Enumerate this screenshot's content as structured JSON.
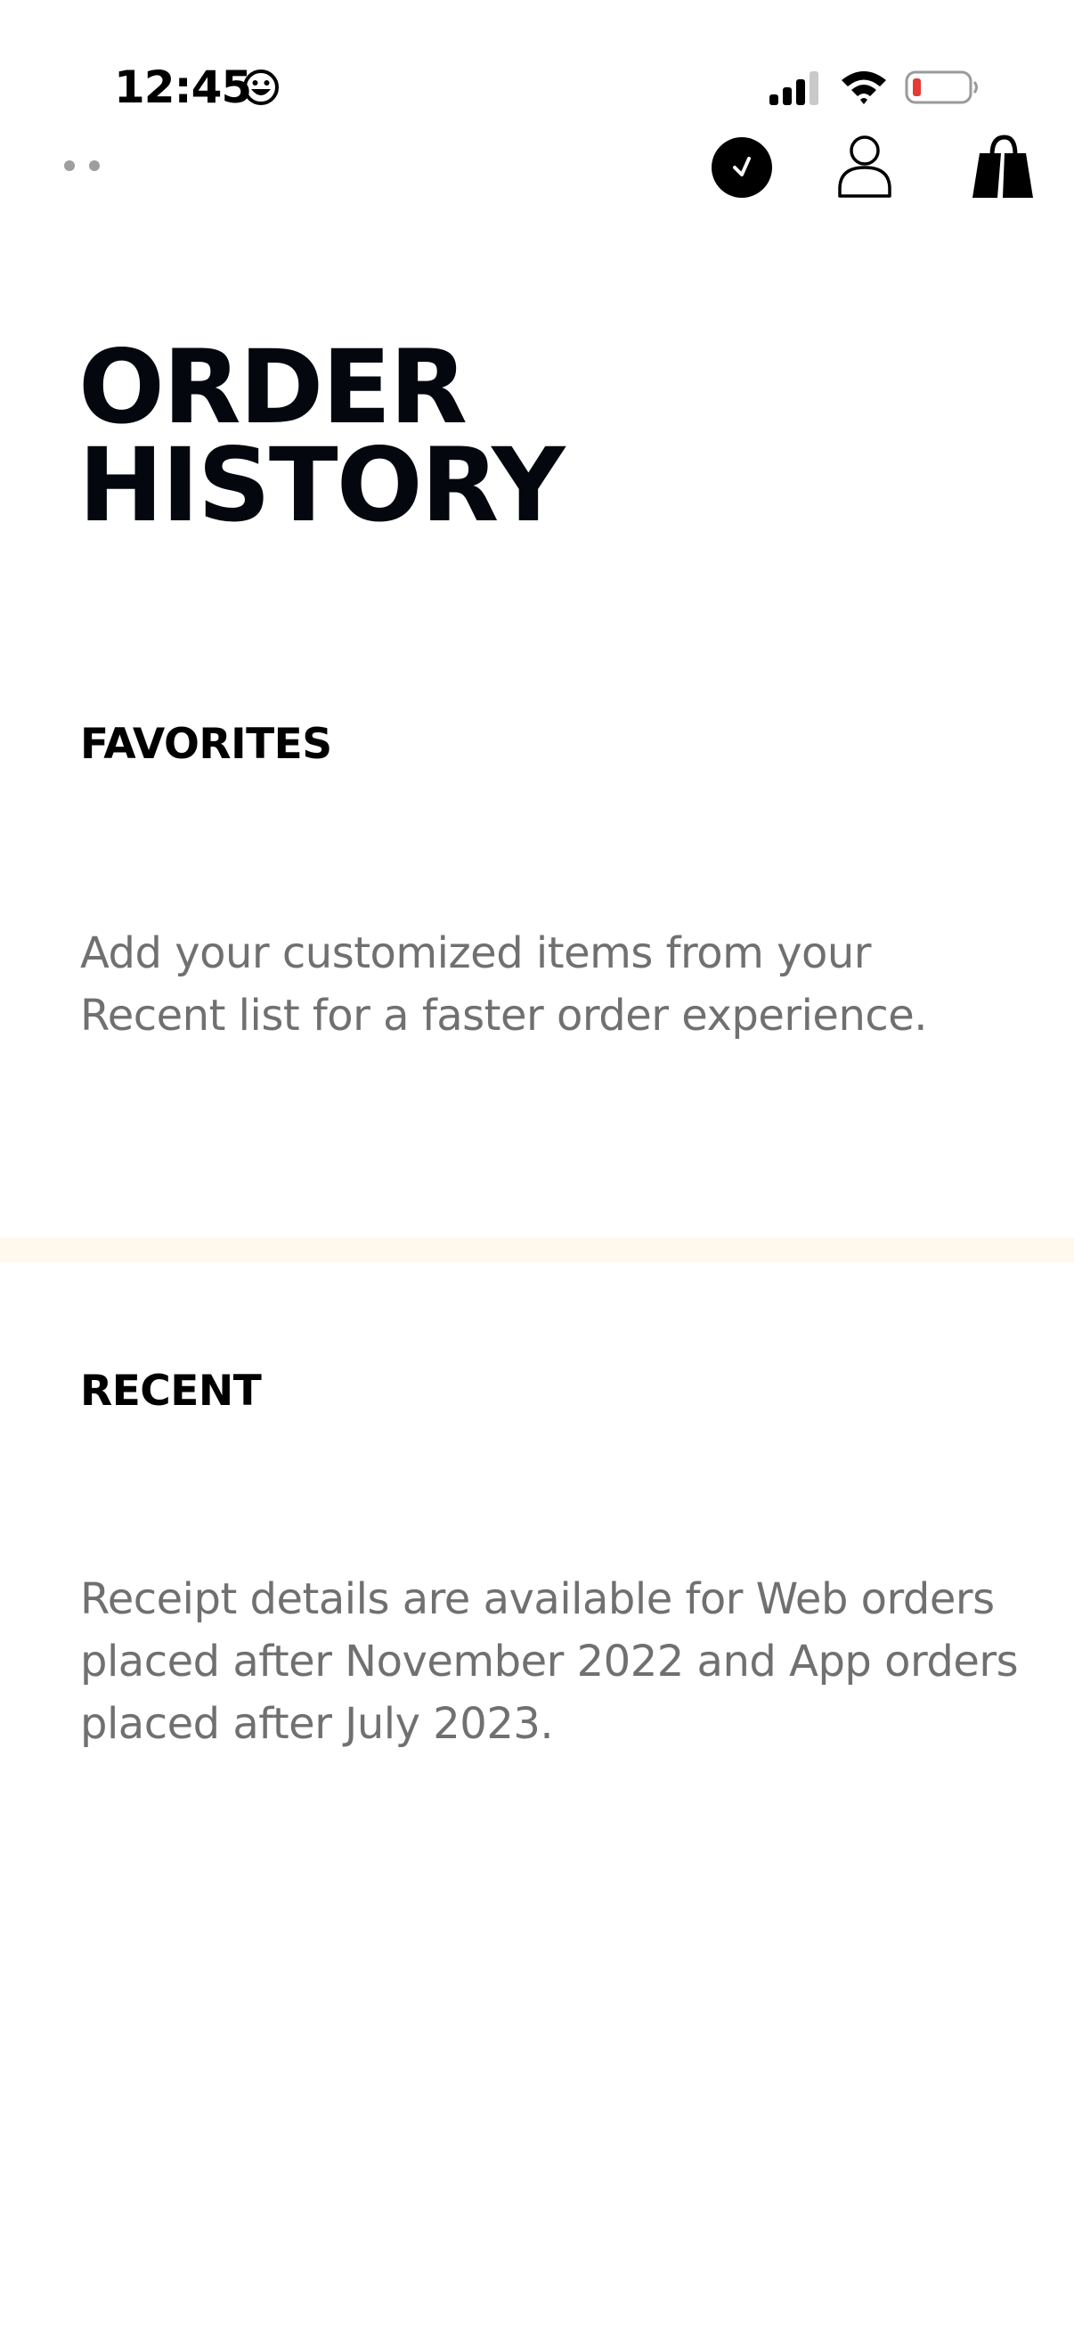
{
  "status_bar": {
    "time": "12:45",
    "emoji_icon": "smiley-face-icon",
    "signal_icon": "cellular-signal-icon",
    "wifi_icon": "wifi-icon",
    "battery_icon": "battery-low-icon",
    "battery_color": "#e53935"
  },
  "nav": {
    "menu_icon": "more-dots-icon",
    "recent_icon": "clock-icon",
    "account_icon": "person-icon",
    "bag_icon": "shopping-bag-icon"
  },
  "page": {
    "title_line1": "ORDER",
    "title_line2": "HISTORY"
  },
  "favorites": {
    "heading": "FAVORITES",
    "body": "Add your customized items from your Recent list for a faster order experience."
  },
  "recent": {
    "heading": "RECENT",
    "body": "Receipt details are available for Web orders placed after November 2022 and App orders placed after July 2023."
  },
  "colors": {
    "title": "#05070f",
    "body_text": "#707070",
    "divider": "#fff8ec"
  }
}
